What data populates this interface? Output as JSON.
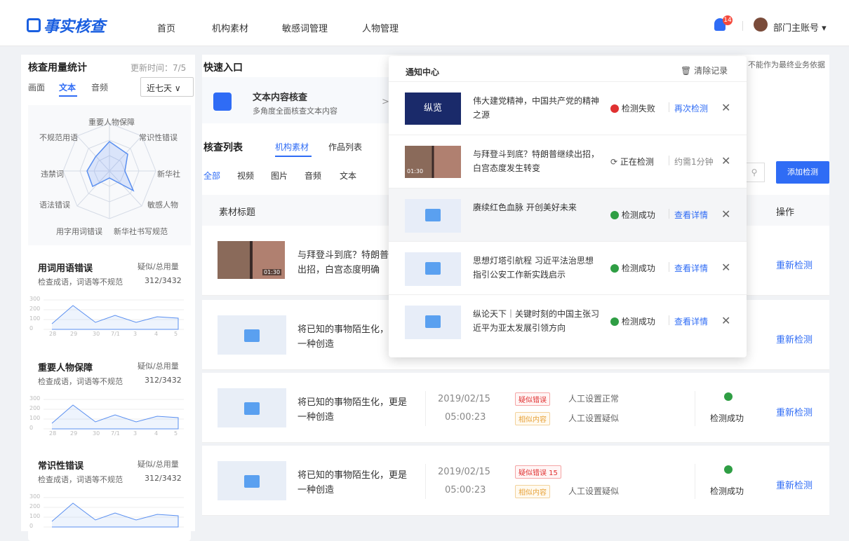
{
  "app": {
    "logo_text": "事实核查",
    "nav": [
      "首页",
      "机构素材",
      "敏感词管理",
      "人物管理"
    ],
    "notif_count": "14",
    "account": "部门主账号 ▾"
  },
  "stats": {
    "title": "核查用量统计",
    "updated": "更新时间：7/5",
    "tabs": [
      "画面",
      "文本",
      "音频"
    ],
    "range": "近七天 ∨",
    "radar": {
      "labels": [
        "重要人物保障",
        "常识性错误",
        "新华社",
        "敏感人物",
        "用字用词错误",
        "新华社书写规范",
        "语法错误",
        "违禁词",
        "不规范用语"
      ]
    },
    "cards": [
      {
        "title": "用词用语错误",
        "desc": "检查成语，词语等不规范",
        "col": "疑似/总用量",
        "value": "312/3432"
      },
      {
        "title": "重要人物保障",
        "desc": "检查成语，词语等不规范",
        "col": "疑似/总用量",
        "value": "312/3432"
      },
      {
        "title": "常识性错误",
        "desc": "检查成语，词语等不规范",
        "col": "疑似/总用量",
        "value": "312/3432"
      }
    ],
    "mini_axis": {
      "y": [
        "300",
        "200",
        "100",
        "0"
      ],
      "x": [
        "28",
        "29",
        "30",
        "7/1",
        "3",
        "4",
        "5"
      ]
    }
  },
  "quick": {
    "title": "快速入口",
    "item_title": "文本内容核查",
    "item_desc": "多角度全面核查文本内容",
    "arrow": ">"
  },
  "list": {
    "title": "核查列表",
    "tabs": [
      "机构素材",
      "作品列表"
    ],
    "filters": [
      "全部",
      "视频",
      "图片",
      "音频",
      "文本"
    ],
    "add_btn": "添加检测",
    "col_title": "素材标题",
    "col_op": "操作",
    "disclaimer": "不能作为最终业务依据",
    "rows": [
      {
        "title": "与拜登斗到底？特朗普继续出招，白宫态度明确",
        "dur": "01:30",
        "op": "重新检测"
      },
      {
        "title": "将已知的事物陌生化，更是一种创造",
        "op": "重新检测"
      },
      {
        "title": "将已知的事物陌生化，更是一种创造",
        "date": "2019/02/15",
        "time": "05:00:23",
        "tag1": "疑似错误",
        "tag1_text": "人工设置正常",
        "tag2": "相似内容",
        "tag2_text": "人工设置疑似",
        "status": "检测成功",
        "op": "重新检测"
      },
      {
        "title": "将已知的事物陌生化，更是一种创造",
        "date": "2019/02/15",
        "time": "05:00:23",
        "tag1": "疑似错误 15",
        "tag2": "相似内容",
        "tag2_text": "人工设置疑似",
        "status": "检测成功",
        "op": "重新检测"
      }
    ]
  },
  "notifications": {
    "title": "通知中心",
    "clear": "清除记录",
    "items": [
      {
        "title": "伟大建党精神，中国共产党的精神之源",
        "thumb_text": "纵览",
        "status": "检测失败",
        "action": "再次检测",
        "x": "✕"
      },
      {
        "title": "与拜登斗到底？特朗普继续出招，白宫态度发生转变",
        "dur": "01:30",
        "status": "正在检测",
        "action": "约需1分钟",
        "x": "✕"
      },
      {
        "title": "赓续红色血脉 开创美好未来",
        "status": "检测成功",
        "action": "查看详情",
        "x": "✕"
      },
      {
        "title": "思想灯塔引航程 习近平法治思想指引公安工作新实践启示",
        "status": "检测成功",
        "action": "查看详情",
        "x": "✕"
      },
      {
        "title": "纵论天下｜关键时刻的中国主张习近平为亚太发展引领方向",
        "status": "检测成功",
        "action": "查看详情",
        "x": "✕"
      }
    ]
  }
}
